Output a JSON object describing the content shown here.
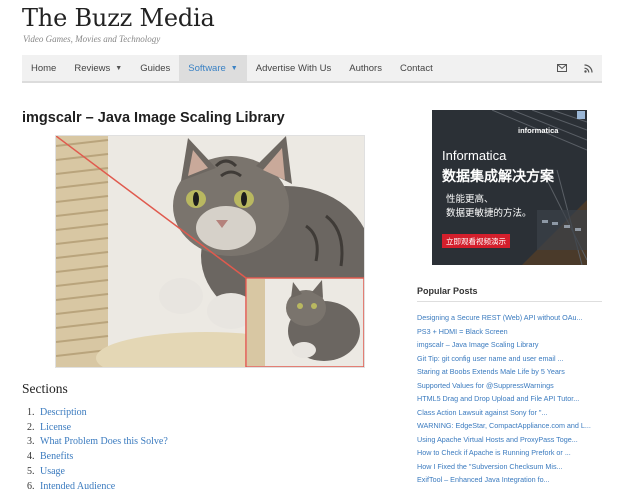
{
  "site": {
    "title": "The Buzz Media",
    "tagline": "Video Games, Movies and Technology"
  },
  "nav": {
    "items": [
      {
        "label": "Home",
        "dropdown": false,
        "active": false
      },
      {
        "label": "Reviews",
        "dropdown": true,
        "active": false
      },
      {
        "label": "Guides",
        "dropdown": false,
        "active": false
      },
      {
        "label": "Software",
        "dropdown": true,
        "active": true
      },
      {
        "label": "Advertise With Us",
        "dropdown": false,
        "active": false
      },
      {
        "label": "Authors",
        "dropdown": false,
        "active": false
      },
      {
        "label": "Contact",
        "dropdown": false,
        "active": false
      }
    ],
    "icons": [
      "mail-icon",
      "rss-icon"
    ]
  },
  "article": {
    "title": "imgscalr – Java Image Scaling Library"
  },
  "sections": {
    "heading": "Sections",
    "items": [
      {
        "num": "1.",
        "label": "Description"
      },
      {
        "num": "2.",
        "label": "License"
      },
      {
        "num": "3.",
        "label": "What Problem Does this Solve?"
      },
      {
        "num": "4.",
        "label": "Benefits"
      },
      {
        "num": "5.",
        "label": "Usage"
      },
      {
        "num": "6.",
        "label": "Intended Audience"
      }
    ]
  },
  "ad": {
    "brand": "informatica",
    "title": "Informatica",
    "headline": "数据集成解决方案",
    "line1": "性能更高、",
    "line2": "数据更敏捷的方法。",
    "cta": "立即观看视频演示"
  },
  "popular_posts": {
    "heading": "Popular Posts",
    "items": [
      "Designing a Secure REST (Web) API without OAu...",
      "PS3 + HDMI = Black Screen",
      "imgscalr – Java Image Scaling Library",
      "Git Tip: git config user name and user email ...",
      "Staring at Boobs Extends Male Life by 5 Years",
      "Supported Values for @SuppressWarnings",
      "HTML5 Drag and Drop Upload and File API Tutor...",
      "Class Action Lawsuit against Sony for \"...",
      "WARNING: EdgeStar, CompactAppliance.com and L...",
      "Using Apache Virtual Hosts and ProxyPass Toge...",
      "How to Check if Apache is Running Prefork or ...",
      "How I Fixed the \"Subversion Checksum Mis...",
      "ExifTool – Enhanced Java Integration fo..."
    ]
  },
  "colors": {
    "link": "#3b7bbf",
    "nav_active": "#3b82c4",
    "accent_red": "#d41f2c"
  }
}
